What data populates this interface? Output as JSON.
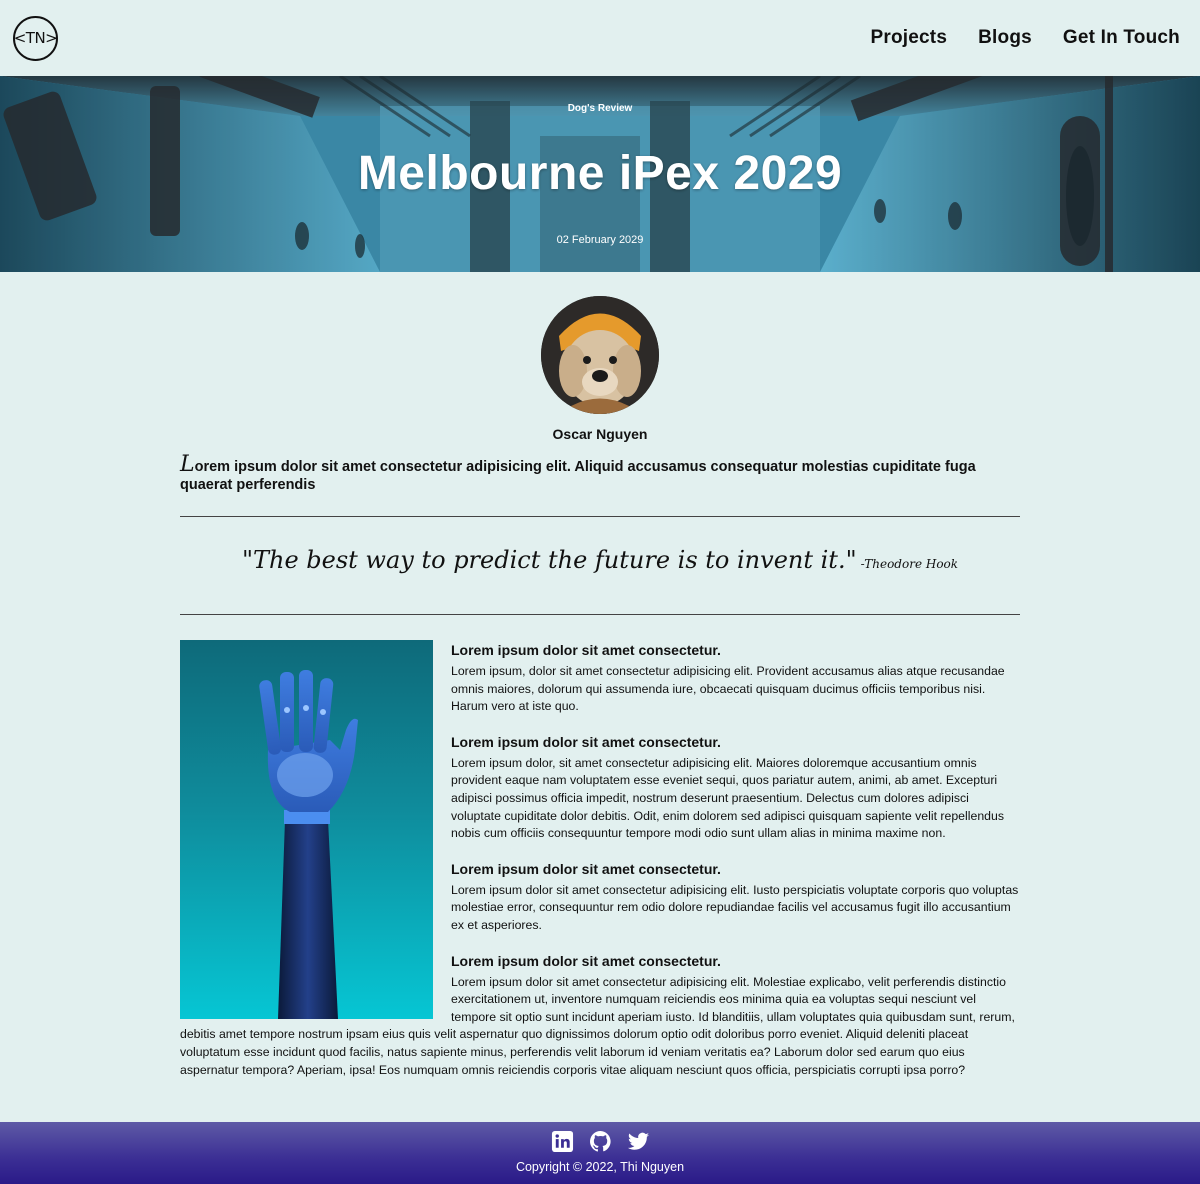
{
  "nav": {
    "logo_text": "<TN>",
    "links": [
      "Projects",
      "Blogs",
      "Get In Touch"
    ]
  },
  "hero": {
    "category": "Dog's Review",
    "title": "Melbourne iPex 2029",
    "date": "02 February 2029"
  },
  "author": {
    "name": "Oscar Nguyen",
    "avatar_icon": "dog-avatar-photo"
  },
  "lead": {
    "dropcap": "L",
    "text": "orem ipsum dolor sit amet consectetur adipisicing elit. Aliquid accusamus consequatur molestias cupiditate fuga quaerat perferendis"
  },
  "quote": {
    "text": "\"The best way to predict the future is to invent it.\"",
    "author": "-Theodore Hook"
  },
  "article": {
    "image_icon": "robotic-hand-photo",
    "sections": [
      {
        "heading": "Lorem ipsum dolor sit amet consectetur.",
        "body": "Lorem ipsum, dolor sit amet consectetur adipisicing elit. Provident accusamus alias atque recusandae omnis maiores, dolorum qui assumenda iure, obcaecati quisquam ducimus officiis temporibus nisi. Harum vero at iste quo."
      },
      {
        "heading": "Lorem ipsum dolor sit amet consectetur.",
        "body": "Lorem ipsum dolor, sit amet consectetur adipisicing elit. Maiores doloremque accusantium omnis provident eaque nam voluptatem esse eveniet sequi, quos pariatur autem, animi, ab amet. Excepturi adipisci possimus officia impedit, nostrum deserunt praesentium. Delectus cum dolores adipisci voluptate cupiditate dolor debitis. Odit, enim dolorem sed adipisci quisquam sapiente velit repellendus nobis cum officiis consequuntur tempore modi odio sunt ullam alias in minima maxime non."
      },
      {
        "heading": "Lorem ipsum dolor sit amet consectetur.",
        "body": "Lorem ipsum dolor sit amet consectetur adipisicing elit. Iusto perspiciatis voluptate corporis quo voluptas molestiae error, consequuntur rem odio dolore repudiandae facilis vel accusamus fugit illo accusantium ex et asperiores."
      },
      {
        "heading": "Lorem ipsum dolor sit amet consectetur.",
        "body": "Lorem ipsum dolor sit amet consectetur adipisicing elit. Molestiae explicabo, velit perferendis distinctio exercitationem ut, inventore numquam reiciendis eos minima quia ea voluptas sequi nesciunt vel tempore sit optio sunt incidunt aperiam iusto. Id blanditiis, ullam voluptates quia quibusdam sunt, rerum, debitis amet tempore nostrum ipsam eius quis velit aspernatur quo dignissimos dolorum optio odit doloribus porro eveniet. Aliquid deleniti placeat voluptatum esse incidunt quod facilis, natus sapiente minus, perferendis velit laborum id veniam veritatis ea? Laborum dolor sed earum quo eius aspernatur tempora? Aperiam, ipsa! Eos numquam omnis reiciendis corporis vitae aliquam nesciunt quos officia, perspiciatis corrupti ipsa porro?"
      }
    ]
  },
  "footer": {
    "social_icons": [
      "linkedin-icon",
      "github-icon",
      "twitter-icon"
    ],
    "copyright": "Copyright © 2022, Thi Nguyen"
  },
  "colors": {
    "background": "#e2f0ef",
    "footer_top": "#5e5aa6",
    "footer_bottom": "#2a1a88",
    "text": "#111111"
  }
}
